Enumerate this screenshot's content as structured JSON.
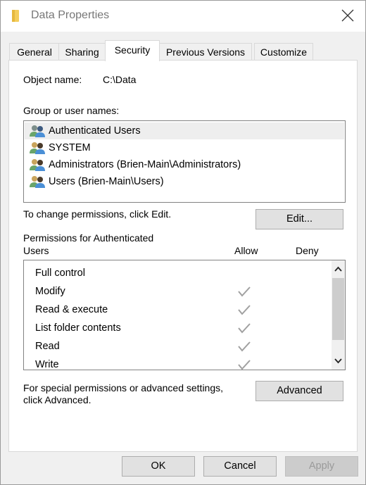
{
  "window": {
    "title": "Data Properties",
    "icon": "folder-icon",
    "close_icon": "close-icon"
  },
  "tabs": [
    {
      "label": "General",
      "active": false
    },
    {
      "label": "Sharing",
      "active": false
    },
    {
      "label": "Security",
      "active": true
    },
    {
      "label": "Previous Versions",
      "active": false
    },
    {
      "label": "Customize",
      "active": false
    }
  ],
  "security": {
    "object_name_label": "Object name:",
    "object_name_value": "C:\\Data",
    "group_label": "Group or user names:",
    "groups": [
      {
        "label": "Authenticated Users",
        "icon": "users-group-icon",
        "selected": true
      },
      {
        "label": "SYSTEM",
        "icon": "users-group-icon",
        "selected": false
      },
      {
        "label": "Administrators (Brien-Main\\Administrators)",
        "icon": "users-group-icon",
        "selected": false
      },
      {
        "label": "Users (Brien-Main\\Users)",
        "icon": "users-group-icon",
        "selected": false
      }
    ],
    "change_hint": "To change permissions, click Edit.",
    "edit_button": "Edit...",
    "permissions_label_line1": "Permissions for Authenticated",
    "permissions_label_line2": "Users",
    "allow_header": "Allow",
    "deny_header": "Deny",
    "permissions": [
      {
        "name": "Full control",
        "allow": false,
        "deny": false
      },
      {
        "name": "Modify",
        "allow": true,
        "deny": false
      },
      {
        "name": "Read & execute",
        "allow": true,
        "deny": false
      },
      {
        "name": "List folder contents",
        "allow": true,
        "deny": false
      },
      {
        "name": "Read",
        "allow": true,
        "deny": false
      },
      {
        "name": "Write",
        "allow": true,
        "deny": false
      }
    ],
    "advanced_hint_line1": "For special permissions or advanced settings,",
    "advanced_hint_line2": "click Advanced.",
    "advanced_button": "Advanced"
  },
  "footer": {
    "ok": "OK",
    "cancel": "Cancel",
    "apply": "Apply",
    "apply_enabled": false
  },
  "colors": {
    "check_gray": "#a0a0a0",
    "disabled_text": "#9a9a9a",
    "selection_bg": "#eeeeee"
  }
}
